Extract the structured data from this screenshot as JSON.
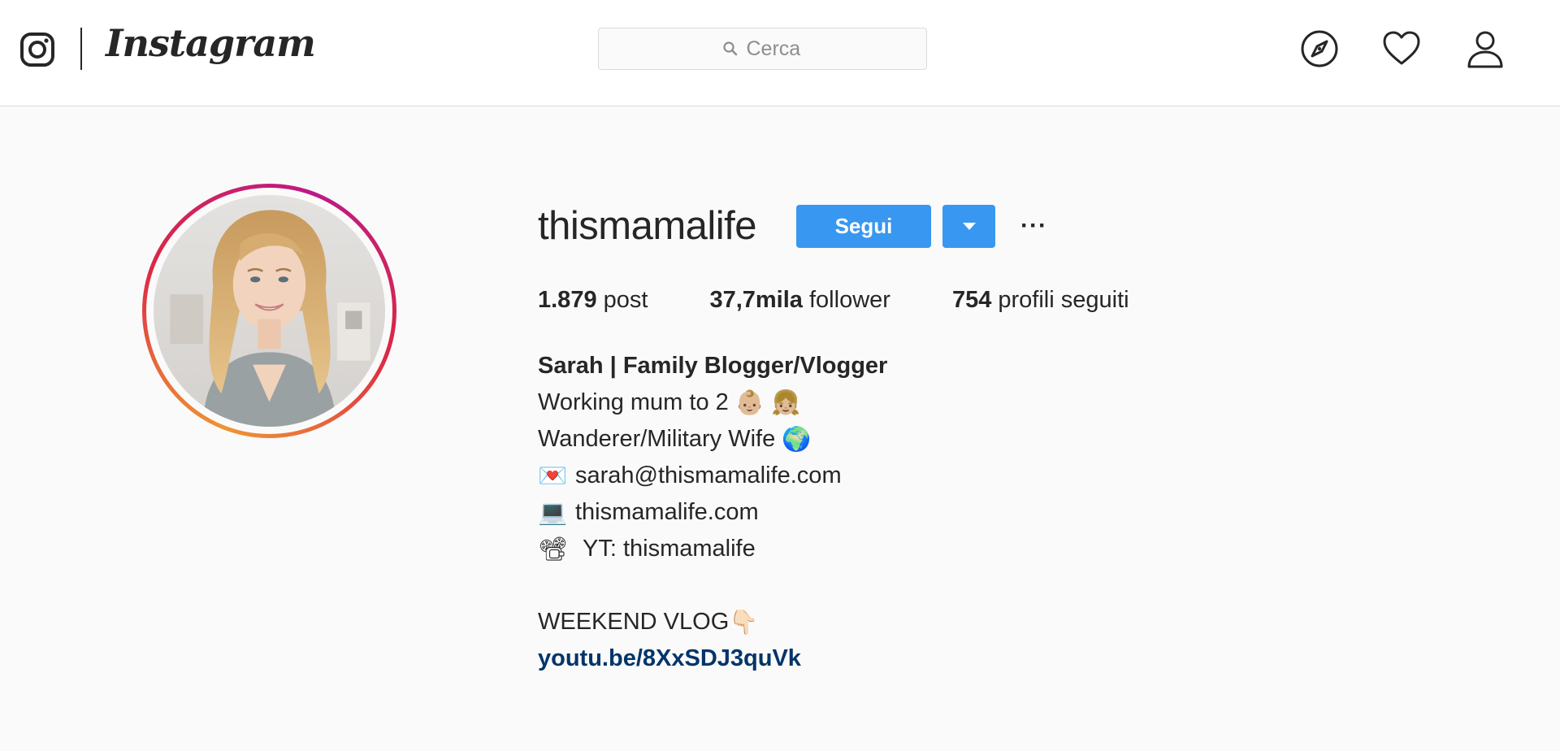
{
  "nav": {
    "brand": "Instagram",
    "search_placeholder": "Cerca"
  },
  "profile": {
    "username": "thismamalife",
    "follow_label": "Segui",
    "stats": {
      "posts_count": "1.879",
      "posts_label": " post",
      "followers_count": "37,7mila",
      "followers_label": " follower",
      "following_count": "754",
      "following_label": " profili seguiti"
    },
    "bio": {
      "full_name": "Sarah | Family Blogger/Vlogger",
      "line1": "Working mum to 2 ",
      "line1_emoji": "👶🏼 👧🏼",
      "line2": "Wanderer/Military Wife ",
      "line2_emoji": "🌍",
      "line3_emoji": "💌",
      "line3": "sarah@thismamalife.com",
      "line4_emoji": "💻",
      "line4": "thismamalife.com",
      "line5_emoji": "📽",
      "line5": "YT: thismamalife",
      "line6": "WEEKEND VLOG",
      "line6_emoji": "👇🏻",
      "link": "youtu.be/8XxSDJ3quVk"
    }
  },
  "colors": {
    "accent": "#3897f0",
    "link": "#003569",
    "text": "#262626"
  },
  "icons": [
    "instagram-glyph-icon",
    "search-icon",
    "compass-icon",
    "heart-icon",
    "user-icon",
    "chevron-down-icon",
    "more-icon"
  ]
}
